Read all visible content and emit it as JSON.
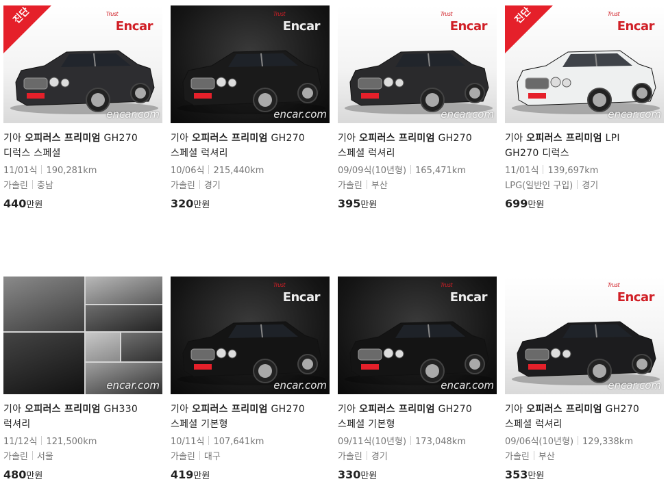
{
  "listings": [
    {
      "brand": "기아",
      "model": "오피러스 프리미엄",
      "trim1": "GH270",
      "trim2": "디럭스 스페셜",
      "year": "11/01식",
      "mileage": "190,281km",
      "fuel": "가솔린",
      "region": "충남",
      "price_num": "440",
      "price_unit": "만원",
      "badge": "진단",
      "logo": "Encar",
      "logo_sub": "Trust",
      "watermark": "encar.com",
      "color": "#2d2d30",
      "bg": "light"
    },
    {
      "brand": "기아",
      "model": "오피러스 프리미엄",
      "trim1": "GH270",
      "trim2": "스페셜 럭셔리",
      "year": "10/06식",
      "mileage": "215,440km",
      "fuel": "가솔린",
      "region": "경기",
      "price_num": "320",
      "price_unit": "만원",
      "badge": "",
      "logo": "Encar",
      "logo_sub": "Trust",
      "watermark": "encar.com",
      "color": "#1a1a1a",
      "bg": "dark"
    },
    {
      "brand": "기아",
      "model": "오피러스 프리미엄",
      "trim1": "GH270",
      "trim2": "스페셜 럭셔리",
      "year": "09/09식(10년형)",
      "mileage": "165,471km",
      "fuel": "가솔린",
      "region": "부산",
      "price_num": "395",
      "price_unit": "만원",
      "badge": "",
      "logo": "Encar",
      "logo_sub": "Trust",
      "watermark": "encar.com",
      "color": "#2a2a2c",
      "bg": "light"
    },
    {
      "brand": "기아",
      "model": "오피러스 프리미엄",
      "trim1": "LPI",
      "trim2": "GH270 디럭스",
      "year": "11/01식",
      "mileage": "139,697km",
      "fuel": "LPG(일반인 구입)",
      "region": "경기",
      "price_num": "699",
      "price_unit": "만원",
      "badge": "진단",
      "logo": "Encar",
      "logo_sub": "Trust",
      "watermark": "encar.com",
      "color": "#eef0f0",
      "bg": "light"
    },
    {
      "brand": "기아",
      "model": "오피러스 프리미엄",
      "trim1": "GH330",
      "trim2": "럭셔리",
      "year": "11/12식",
      "mileage": "121,500km",
      "fuel": "가솔린",
      "region": "서울",
      "price_num": "480",
      "price_unit": "만원",
      "badge": "",
      "logo": "",
      "logo_sub": "",
      "watermark": "encar.com",
      "color": "#1a1a1a",
      "bg": "collage"
    },
    {
      "brand": "기아",
      "model": "오피러스 프리미엄",
      "trim1": "GH270",
      "trim2": "스페셜 기본형",
      "year": "10/11식",
      "mileage": "107,641km",
      "fuel": "가솔린",
      "region": "대구",
      "price_num": "419",
      "price_unit": "만원",
      "badge": "",
      "logo": "Encar",
      "logo_sub": "Trust",
      "watermark": "encar.com",
      "color": "#141414",
      "bg": "dark"
    },
    {
      "brand": "기아",
      "model": "오피러스 프리미엄",
      "trim1": "GH270",
      "trim2": "스페셜 기본형",
      "year": "09/11식(10년형)",
      "mileage": "173,048km",
      "fuel": "가솔린",
      "region": "경기",
      "price_num": "330",
      "price_unit": "만원",
      "badge": "",
      "logo": "Encar",
      "logo_sub": "Trust",
      "watermark": "encar.com",
      "color": "#141414",
      "bg": "dark"
    },
    {
      "brand": "기아",
      "model": "오피러스 프리미엄",
      "trim1": "GH270",
      "trim2": "스페셜 럭셔리",
      "year": "09/06식(10년형)",
      "mileage": "129,338km",
      "fuel": "가솔린",
      "region": "부산",
      "price_num": "353",
      "price_unit": "만원",
      "badge": "",
      "logo": "Encar",
      "logo_sub": "Trust",
      "watermark": "encar.com",
      "color": "#1c1c1e",
      "bg": "light"
    }
  ],
  "theme": {
    "badge_color": "#e5202a",
    "logo_color": "#d01f26"
  }
}
